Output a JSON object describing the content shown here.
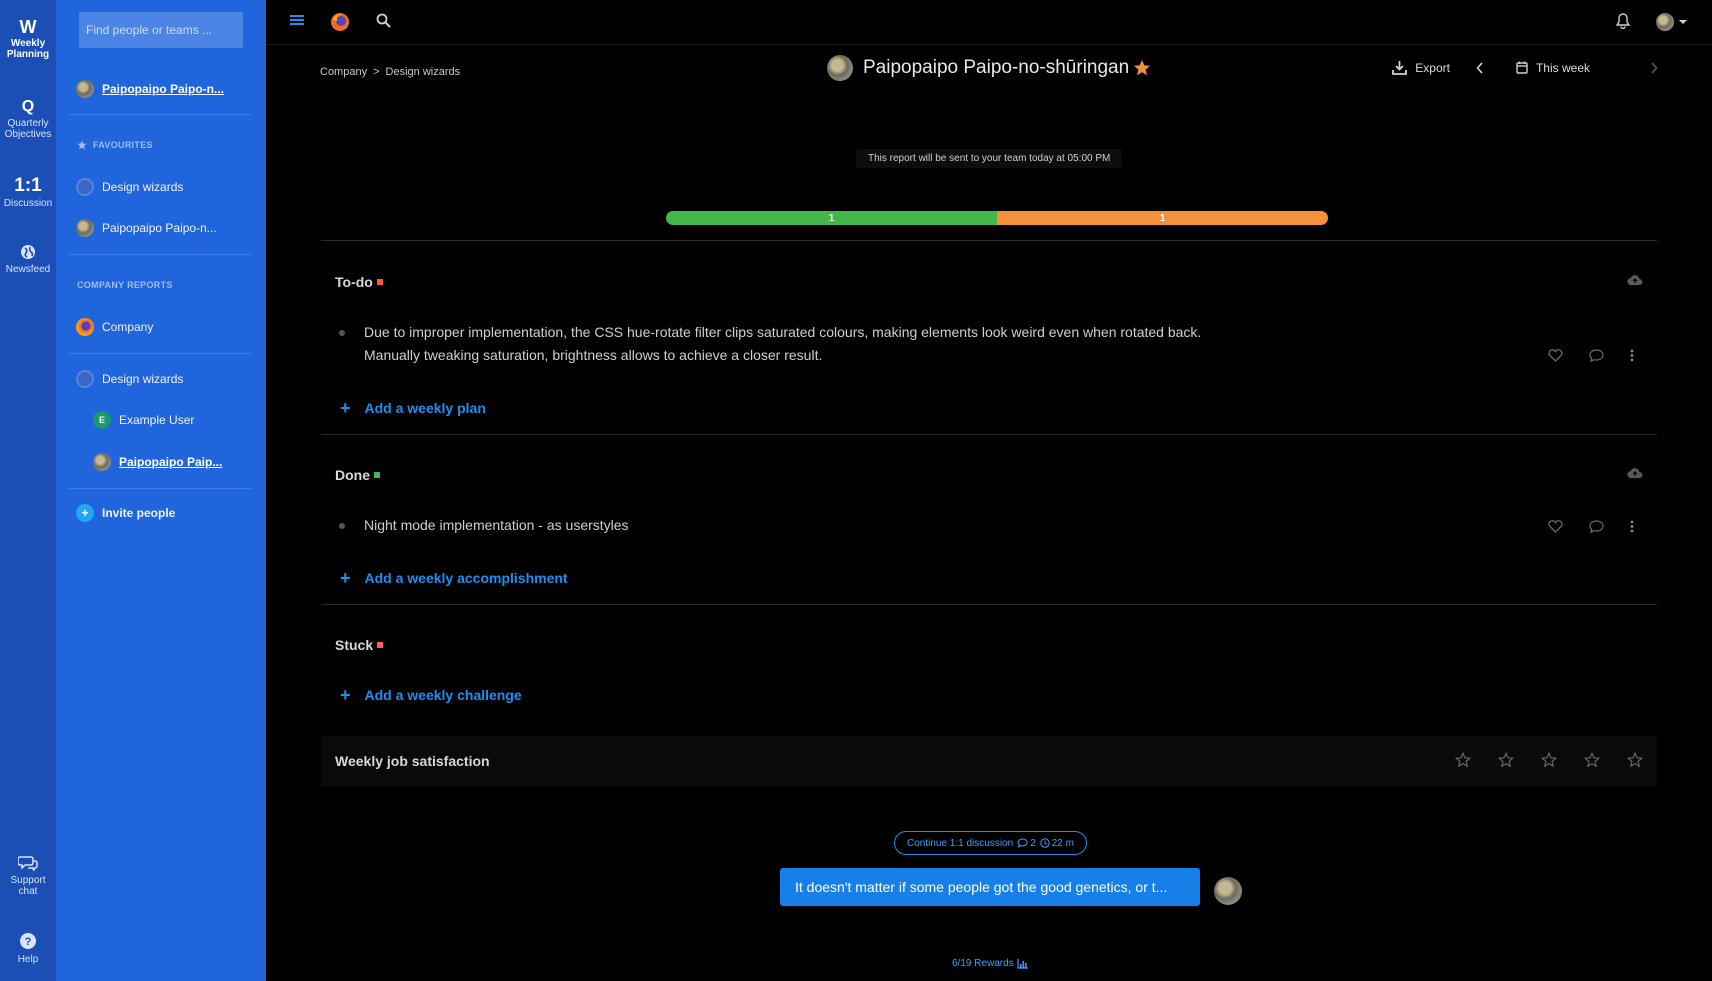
{
  "rail": {
    "brand_letter": "W",
    "weekly_planning": "Weekly Planning",
    "quarterly_letter": "Q",
    "quarterly": "Quarterly Objectives",
    "oneonone_big": "1:1",
    "discussion": "Discussion",
    "newsfeed": "Newsfeed",
    "support": "Support chat",
    "help": "Help"
  },
  "sidebar": {
    "search_placeholder": "Find people or teams ...",
    "current_user": "Paipopaipo Paipo-n...",
    "favourites_head": "FAVOURITES",
    "favourites": [
      "Design wizards",
      "Paipopaipo Paipo-n..."
    ],
    "reports_head": "COMPANY REPORTS",
    "company": "Company",
    "team": "Design wizards",
    "members": [
      "Example User",
      "Paipopaipo Paip..."
    ],
    "member_initial": "E",
    "invite": "Invite people"
  },
  "header": {
    "breadcrumb": [
      "Company",
      "Design wizards"
    ],
    "breadcrumb_sep": ">",
    "title": "Paipopaipo Paipo-no-shūringan",
    "export": "Export",
    "period": "This week"
  },
  "notice": "This report will be sent to your team today at 05:00 PM",
  "progress": {
    "green_label": "1",
    "orange_label": "1",
    "green_fraction": 0.5,
    "orange_fraction": 0.5
  },
  "sections": {
    "todo": {
      "title": "To-do",
      "items": [
        "Due to improper implementation, the CSS hue-rotate filter clips saturated colours, making elements look weird even when rotated back.",
        "Manually tweaking saturation, brightness allows to achieve a closer result."
      ],
      "add": "Add a weekly plan"
    },
    "done": {
      "title": "Done",
      "items": [
        "Night mode implementation - as userstyles"
      ],
      "add": "Add a weekly accomplishment"
    },
    "stuck": {
      "title": "Stuck",
      "add": "Add a weekly challenge"
    }
  },
  "satisfaction": {
    "label": "Weekly job satisfaction",
    "rating": 0,
    "max": 5
  },
  "discussion": {
    "continue_label": "Continue 1:1 discussion",
    "comments": "2",
    "time": "22 m",
    "message": "It doesn't matter if some people got the good genetics, or t..."
  },
  "rewards": "6/19 Rewards",
  "colors": {
    "rail": "#1b4fb5",
    "sidebar": "#2065db",
    "accent": "#1f8ef1",
    "star": "#f5913c",
    "todo_marker": "#ff5a36",
    "done_marker": "#45b649",
    "stuck_marker": "#ff5a68"
  }
}
